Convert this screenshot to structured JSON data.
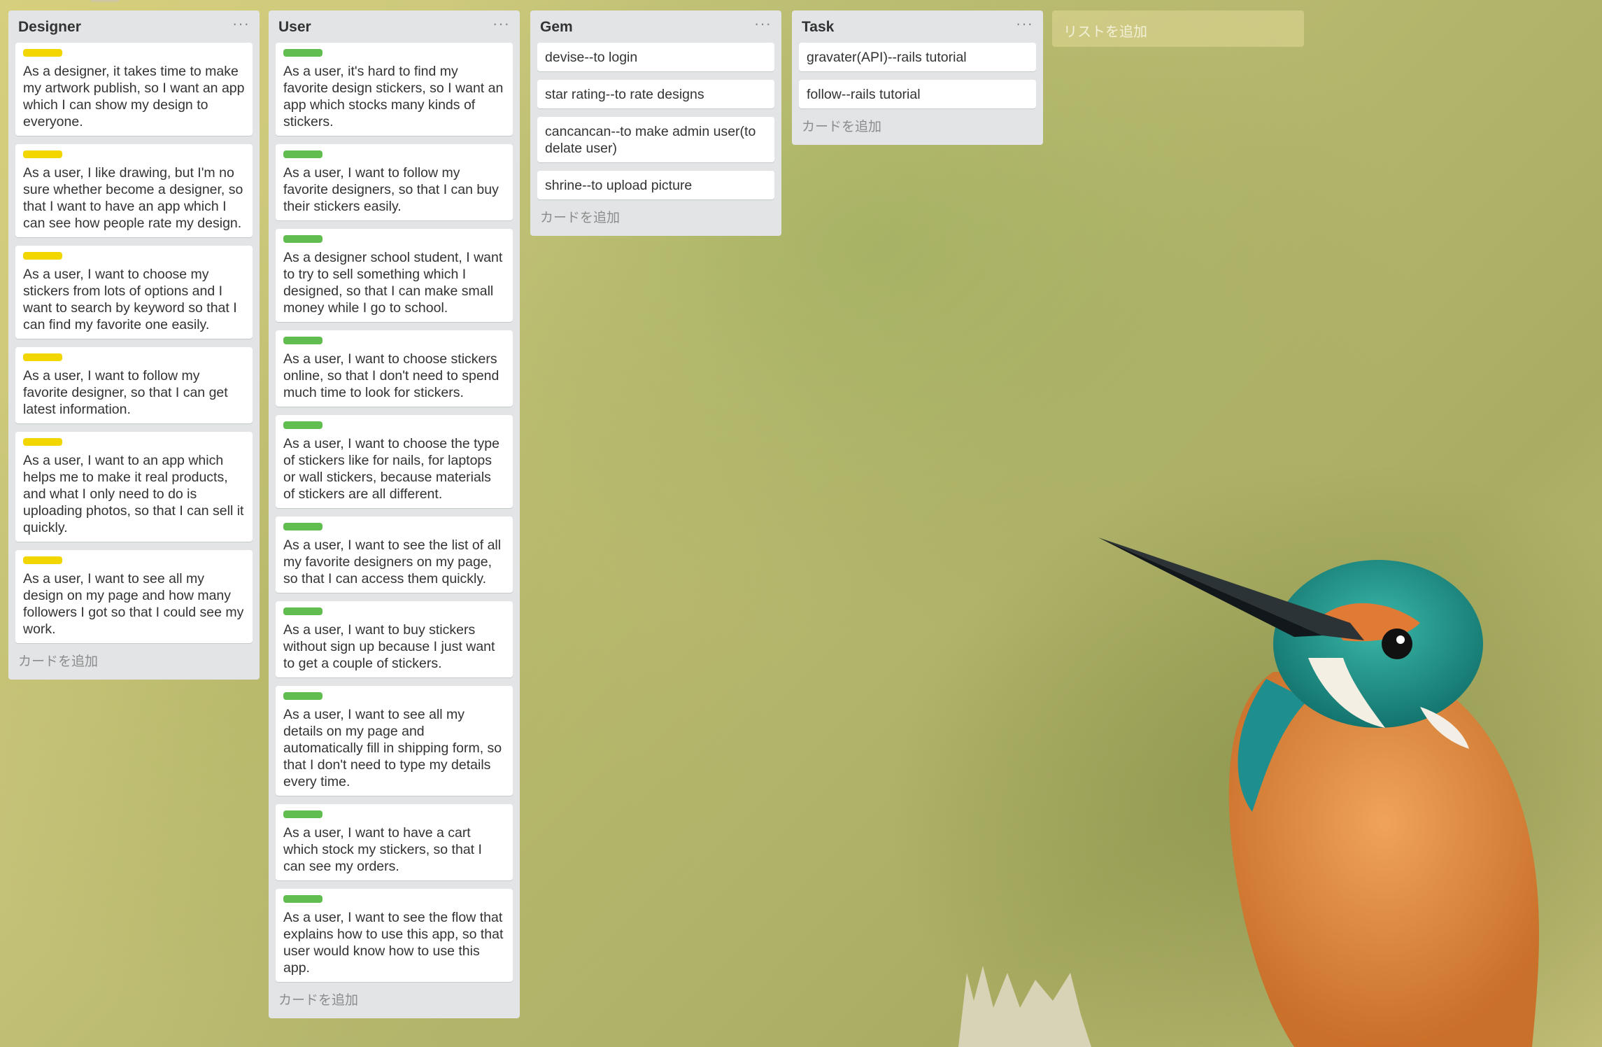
{
  "board": {
    "add_list_label": "リストを追加"
  },
  "lists": [
    {
      "title": "Designer",
      "menu": "···",
      "add_card": "カードを追加",
      "label_color": "#f2d600",
      "cards": [
        "As a designer, it takes time to make my artwork publish, so I want an app which I can show my design to everyone.",
        "As a user, I like drawing, but I'm no sure whether become a designer, so that I want to have an app which I can see how people rate my design.",
        "As a user, I want to choose my stickers from lots of options and I want to search by keyword so that I can find my favorite one easily.",
        "As a user, I want to follow my favorite designer, so that I can get latest information.",
        "As a user, I want to an app which helps me to make it real products, and what I only need to do is uploading photos, so that I can sell it quickly.",
        "As a user, I want to see all my design on my page and how many followers I got so that I could see my work."
      ]
    },
    {
      "title": "User",
      "menu": "···",
      "add_card": "カードを追加",
      "label_color": "#61bd4f",
      "cards": [
        "As a user, it's hard to find my favorite design stickers, so I want an app which stocks many kinds of stickers.",
        "As a user, I want to follow my favorite designers, so that I can buy their stickers easily.",
        "As a designer school student, I want to try to sell something which I designed, so that I can make small money while I go to school.",
        "As a user, I want to choose stickers online, so that I don't need to spend much time to look for stickers.",
        "As a user, I want to choose the type of stickers like for nails, for laptops or wall stickers, because materials of stickers are all different.",
        "As a user, I want to see the list of all my favorite designers on my page, so that I can access them quickly.",
        "As a user, I want to buy stickers without sign up because I just want to get a couple of stickers.",
        "As a user, I want to see all my details on my page and automatically fill in shipping form, so that I don't need to type my details every time.",
        "As a user, I want to have a cart which stock my stickers, so that I can see my orders.",
        "As a user, I want to see the flow that explains how to use this app, so that user would know how to use this app."
      ]
    },
    {
      "title": "Gem",
      "menu": "···",
      "add_card": "カードを追加",
      "cards": [
        "devise--to login",
        "star rating--to rate designs",
        "cancancan--to make admin user(to delate user)",
        "shrine--to upload picture"
      ]
    },
    {
      "title": "Task",
      "menu": "···",
      "add_card": "カードを追加",
      "cards": [
        "gravater(API)--rails tutorial",
        "follow--rails tutorial"
      ]
    }
  ]
}
